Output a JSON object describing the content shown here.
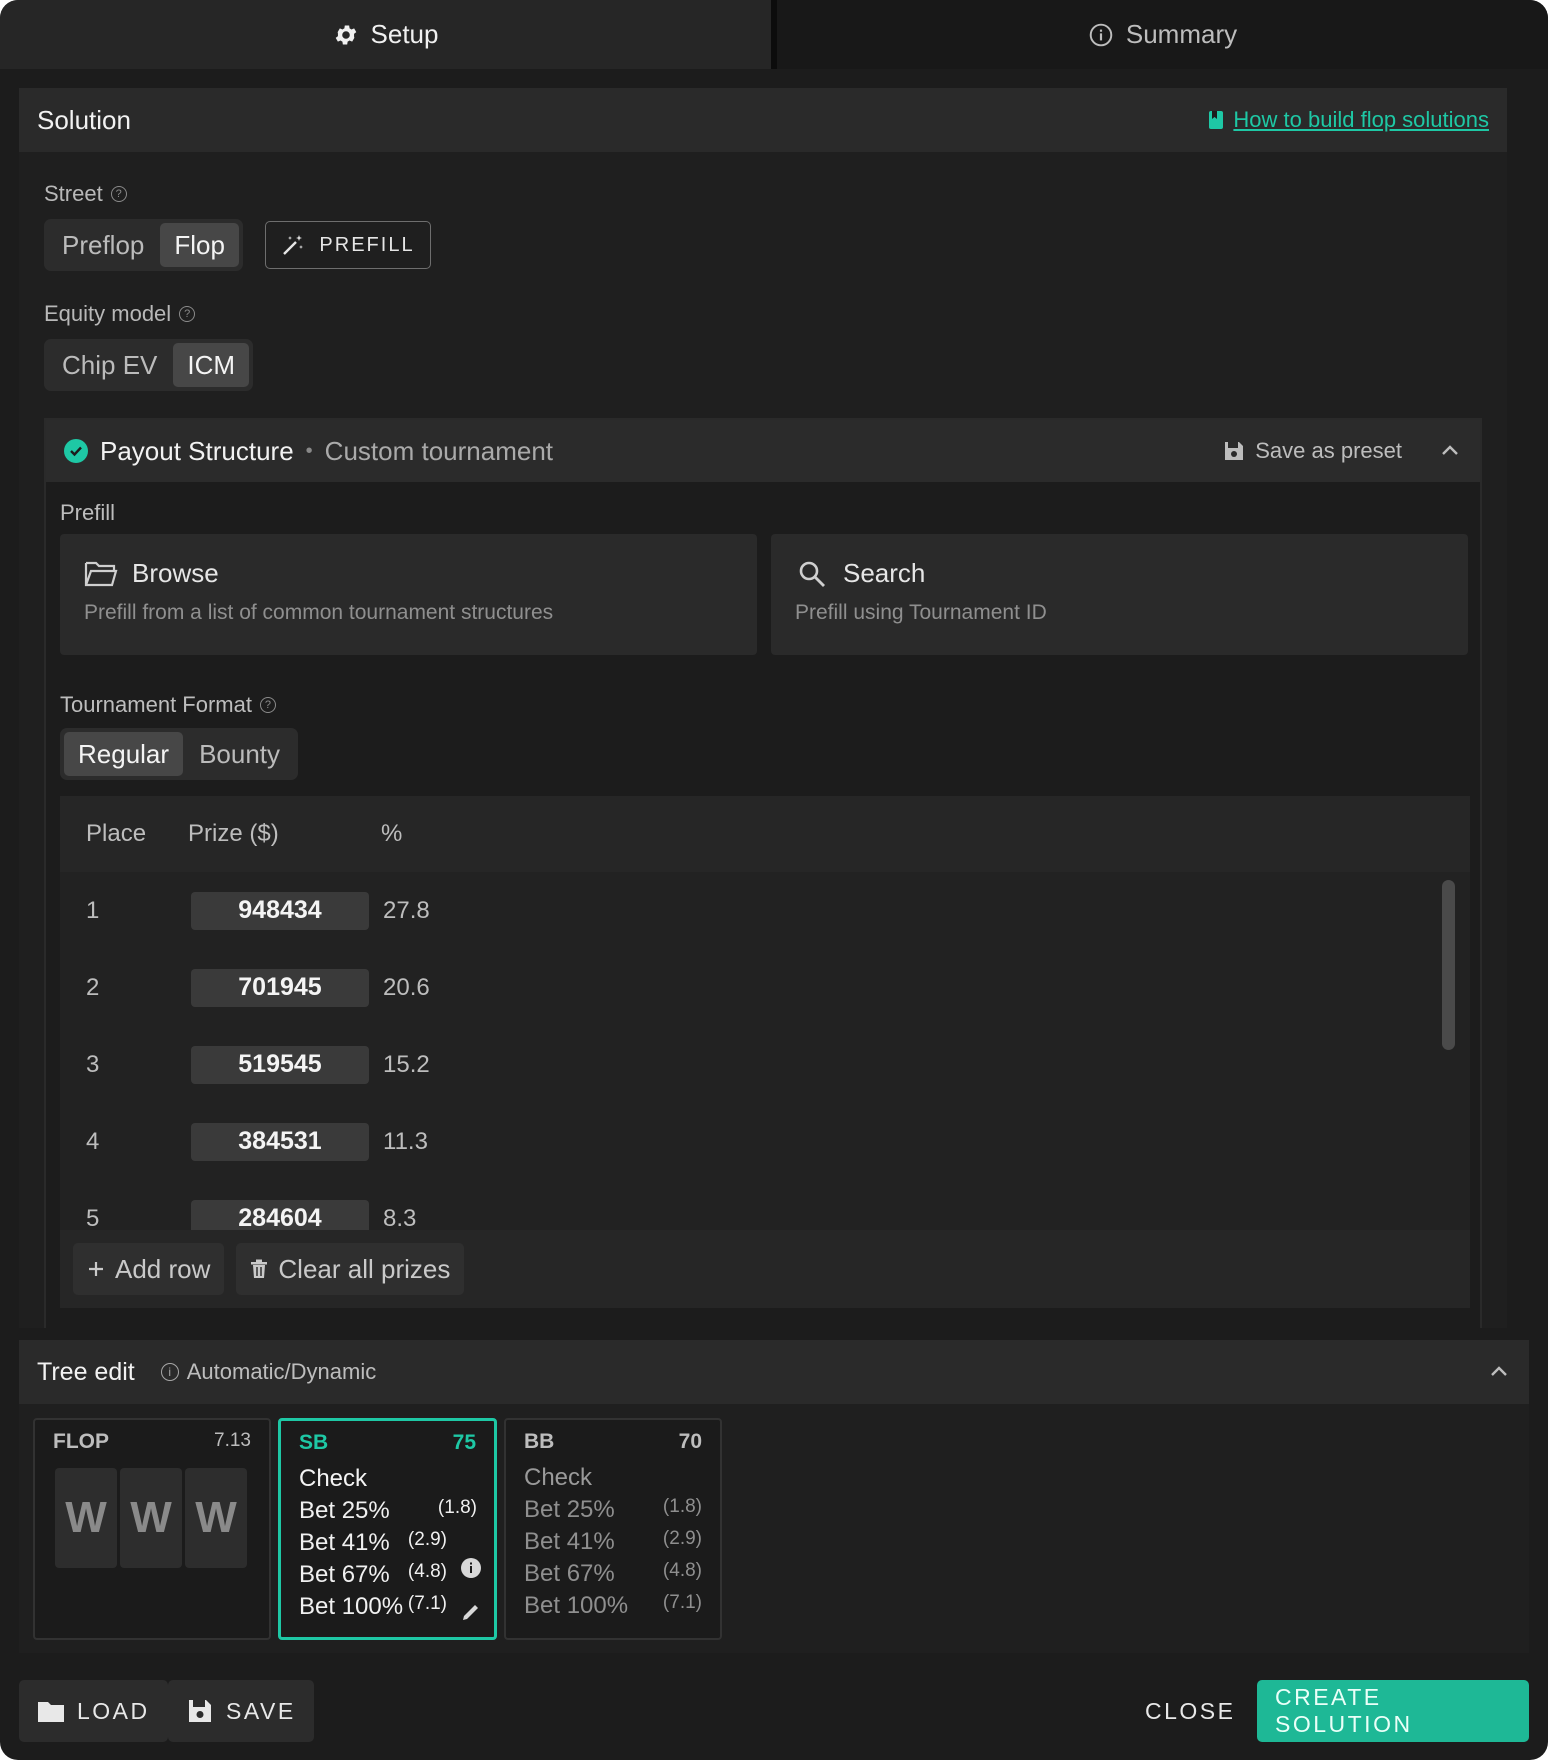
{
  "tabs": [
    {
      "label": "Setup",
      "icon": "gear-icon",
      "active": true
    },
    {
      "label": "Summary",
      "icon": "info-icon",
      "active": false
    }
  ],
  "solution": {
    "title": "Solution",
    "help_link": "How to build flop solutions",
    "street": {
      "label": "Street",
      "options": [
        "Preflop",
        "Flop"
      ],
      "selected": "Flop"
    },
    "prefill_button": "PREFILL",
    "equity_model": {
      "label": "Equity model",
      "options": [
        "Chip EV",
        "ICM"
      ],
      "selected": "ICM"
    }
  },
  "payout": {
    "title": "Payout Structure",
    "separator": "•",
    "subtitle": "Custom tournament",
    "save_preset": "Save as preset",
    "prefill_label": "Prefill",
    "browse": {
      "title": "Browse",
      "subtitle": "Prefill from a list of common tournament structures"
    },
    "search": {
      "title": "Search",
      "subtitle": "Prefill using Tournament ID"
    },
    "tournament_format": {
      "label": "Tournament Format",
      "options": [
        "Regular",
        "Bounty"
      ],
      "selected": "Regular"
    },
    "columns": [
      "Place",
      "Prize ($)",
      "%"
    ],
    "rows": [
      {
        "place": "1",
        "prize": "948434",
        "pct": "27.8"
      },
      {
        "place": "2",
        "prize": "701945",
        "pct": "20.6"
      },
      {
        "place": "3",
        "prize": "519545",
        "pct": "15.2"
      },
      {
        "place": "4",
        "prize": "384531",
        "pct": "11.3"
      },
      {
        "place": "5",
        "prize": "284604",
        "pct": "8.3"
      }
    ],
    "add_row": "Add row",
    "clear_prizes": "Clear all prizes"
  },
  "tree": {
    "title": "Tree edit",
    "mode": "Automatic/Dynamic",
    "flop": {
      "label": "FLOP",
      "value": "7.13",
      "cards": [
        "W",
        "W",
        "W"
      ]
    },
    "sb": {
      "label": "SB",
      "value": "75",
      "actions": [
        {
          "name": "Check",
          "amount": ""
        },
        {
          "name": "Bet 25%",
          "amount": "(1.8)"
        },
        {
          "name": "Bet 41%",
          "amount": "(2.9)"
        },
        {
          "name": "Bet 67%",
          "amount": "(4.8)"
        },
        {
          "name": "Bet 100%",
          "amount": "(7.1)"
        }
      ]
    },
    "bb": {
      "label": "BB",
      "value": "70",
      "actions": [
        {
          "name": "Check",
          "amount": ""
        },
        {
          "name": "Bet 25%",
          "amount": "(1.8)"
        },
        {
          "name": "Bet 41%",
          "amount": "(2.9)"
        },
        {
          "name": "Bet 67%",
          "amount": "(4.8)"
        },
        {
          "name": "Bet 100%",
          "amount": "(7.1)"
        }
      ]
    }
  },
  "footer": {
    "load": "LOAD",
    "save": "SAVE",
    "close": "CLOSE",
    "create": "CREATE SOLUTION"
  },
  "colors": {
    "accent": "#1ec8a5",
    "background": "#1c1c1c",
    "panel": "#2a2a2a"
  }
}
